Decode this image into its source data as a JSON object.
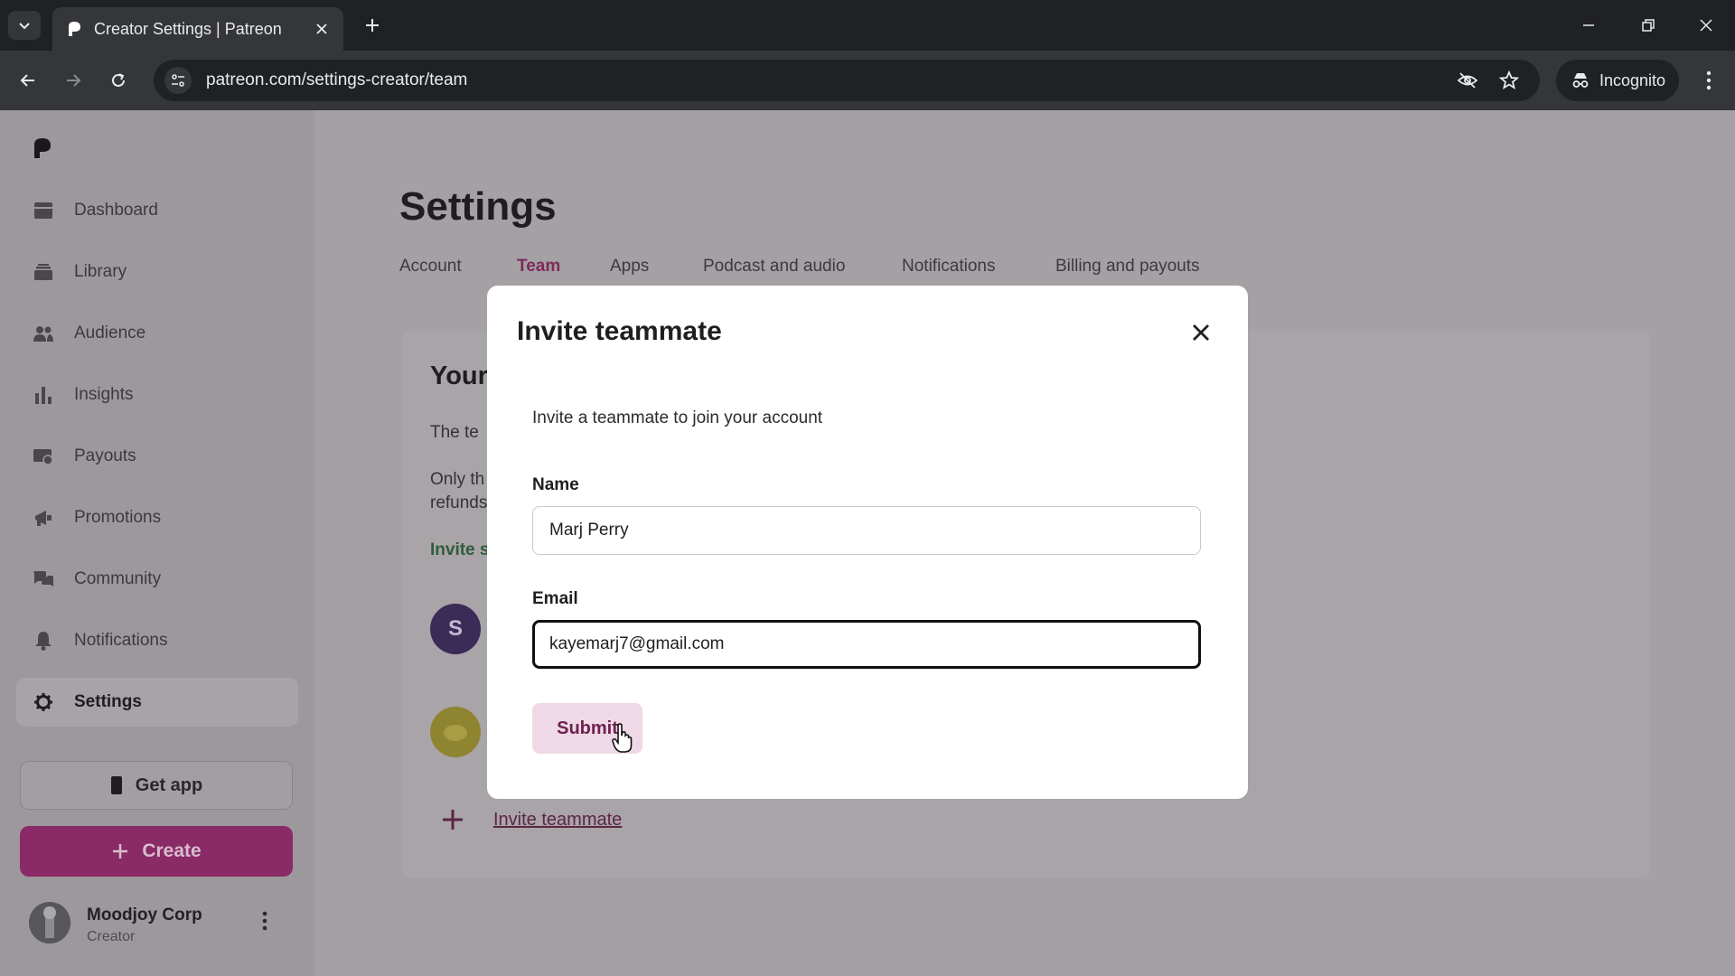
{
  "browser": {
    "tab_title": "Creator Settings | Patreon",
    "url": "patreon.com/settings-creator/team",
    "incognito_label": "Incognito"
  },
  "sidebar": {
    "items": [
      {
        "label": "Dashboard",
        "icon": "dashboard-icon"
      },
      {
        "label": "Library",
        "icon": "library-icon"
      },
      {
        "label": "Audience",
        "icon": "audience-icon"
      },
      {
        "label": "Insights",
        "icon": "insights-icon"
      },
      {
        "label": "Payouts",
        "icon": "payouts-icon"
      },
      {
        "label": "Promotions",
        "icon": "promotions-icon"
      },
      {
        "label": "Community",
        "icon": "community-icon"
      },
      {
        "label": "Notifications",
        "icon": "bell-icon"
      },
      {
        "label": "Settings",
        "icon": "gear-icon",
        "active": true
      }
    ],
    "get_app_label": "Get app",
    "create_label": "Create",
    "user": {
      "name": "Moodjoy Corp",
      "role": "Creator"
    }
  },
  "main": {
    "title": "Settings",
    "tabs": [
      {
        "label": "Account"
      },
      {
        "label": "Team",
        "active": true
      },
      {
        "label": "Apps"
      },
      {
        "label": "Podcast and audio"
      },
      {
        "label": "Notifications"
      },
      {
        "label": "Billing and payouts"
      }
    ],
    "team_heading_partial": "Your",
    "team_text_1_partial": "The te",
    "team_text_2a_partial": "Only th",
    "team_text_2b_partial": "refunds",
    "team_link_partial": "Invite s",
    "member_initial": "S",
    "invite_link": "Invite teammate"
  },
  "modal": {
    "title": "Invite teammate",
    "description": "Invite a teammate to join your account",
    "name_label": "Name",
    "name_value": "Marj Perry",
    "email_label": "Email",
    "email_value": "kayemarj7@gmail.com",
    "submit_label": "Submit"
  },
  "colors": {
    "brand": "#8a2a66",
    "active_tab": "#7c2c5a",
    "submit_bg": "#efd9e6"
  }
}
